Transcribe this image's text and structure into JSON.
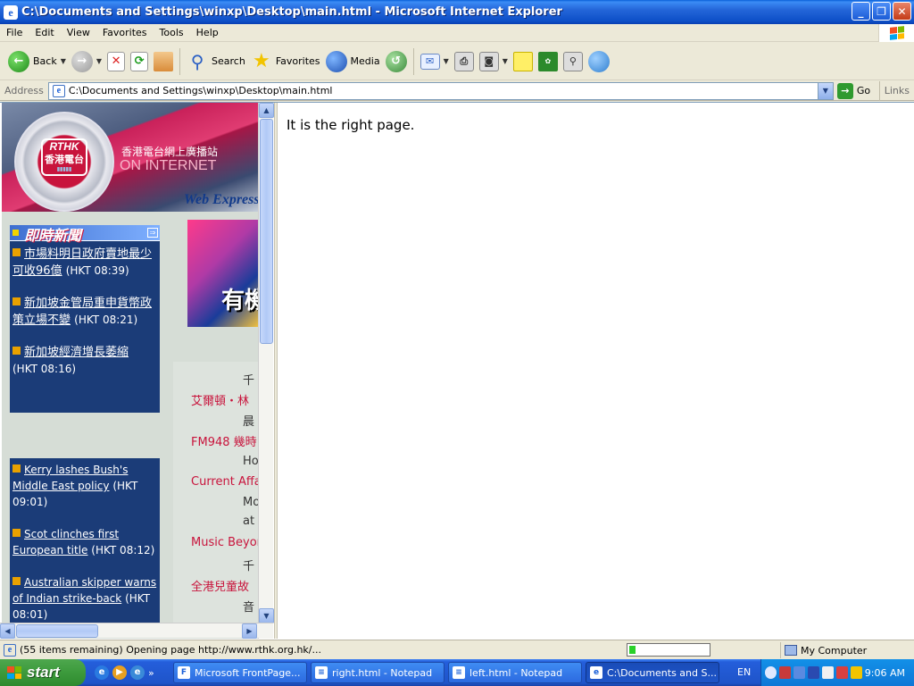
{
  "window": {
    "title": "C:\\Documents and Settings\\winxp\\Desktop\\main.html - Microsoft Internet Explorer",
    "minimize": "_",
    "maximize": "❐",
    "close": "✕"
  },
  "menu": [
    "File",
    "Edit",
    "View",
    "Favorites",
    "Tools",
    "Help"
  ],
  "toolbar": {
    "back": "Back",
    "search": "Search",
    "favorites": "Favorites",
    "media": "Media"
  },
  "address": {
    "label": "Address",
    "url": "C:\\Documents and Settings\\winxp\\Desktop\\main.html",
    "go": "Go",
    "links": "Links"
  },
  "right_frame": {
    "text": "It is the right page."
  },
  "left_frame": {
    "logo_line1": "RTHK",
    "logo_line2": "香港電台",
    "tagline": "香港電台網上廣播站",
    "on_internet": "ON INTERNET",
    "web_express": "Web Express",
    "news_title": "即時新聞",
    "news_chinese": [
      {
        "headline": "市場料明日政府賣地最少可收96億",
        "time": "(HKT 08:39)"
      },
      {
        "headline": "新加坡金管局重申貨幣政策立場不變",
        "time": "(HKT 08:21)"
      },
      {
        "headline": "新加坡經濟增長萎縮",
        "time": "(HKT 08:16)"
      }
    ],
    "news_english": [
      {
        "headline": "Kerry lashes Bush's Middle East policy",
        "time": "(HKT 09:01)"
      },
      {
        "headline": "Scot clinches first European title",
        "time": "(HKT 08:12)"
      },
      {
        "headline": "Australian skipper warns of Indian strike-back",
        "time": "(HKT 08:01)"
      }
    ],
    "banner_text": "有機",
    "schedule": [
      {
        "text": "千",
        "style": "dark"
      },
      {
        "text": "艾爾頓・林",
        "style": "red"
      },
      {
        "text": "晨",
        "style": "dark"
      },
      {
        "text": "FM948 幾時",
        "style": "red"
      },
      {
        "text": "Hon",
        "style": "dark"
      },
      {
        "text": "Current Affai",
        "style": "red"
      },
      {
        "text": "Mo",
        "style": "dark"
      },
      {
        "text": "at a",
        "style": "dark"
      },
      {
        "text": "Music Beyond",
        "style": "red"
      },
      {
        "text": "千",
        "style": "dark"
      },
      {
        "text": "全港兒童故",
        "style": "red"
      },
      {
        "text": "音",
        "style": "dark"
      }
    ]
  },
  "status": {
    "text": "(55 items remaining) Opening page http://www.rthk.org.hk/...",
    "progress": 0.08,
    "zone": "My Computer"
  },
  "taskbar": {
    "start": "start",
    "tasks": [
      {
        "label": "Microsoft FrontPage...",
        "active": false
      },
      {
        "label": "right.html - Notepad",
        "active": false
      },
      {
        "label": "left.html - Notepad",
        "active": false
      },
      {
        "label": "C:\\Documents and S...",
        "active": true
      }
    ],
    "lang": "EN",
    "clock": "9:06 AM"
  }
}
